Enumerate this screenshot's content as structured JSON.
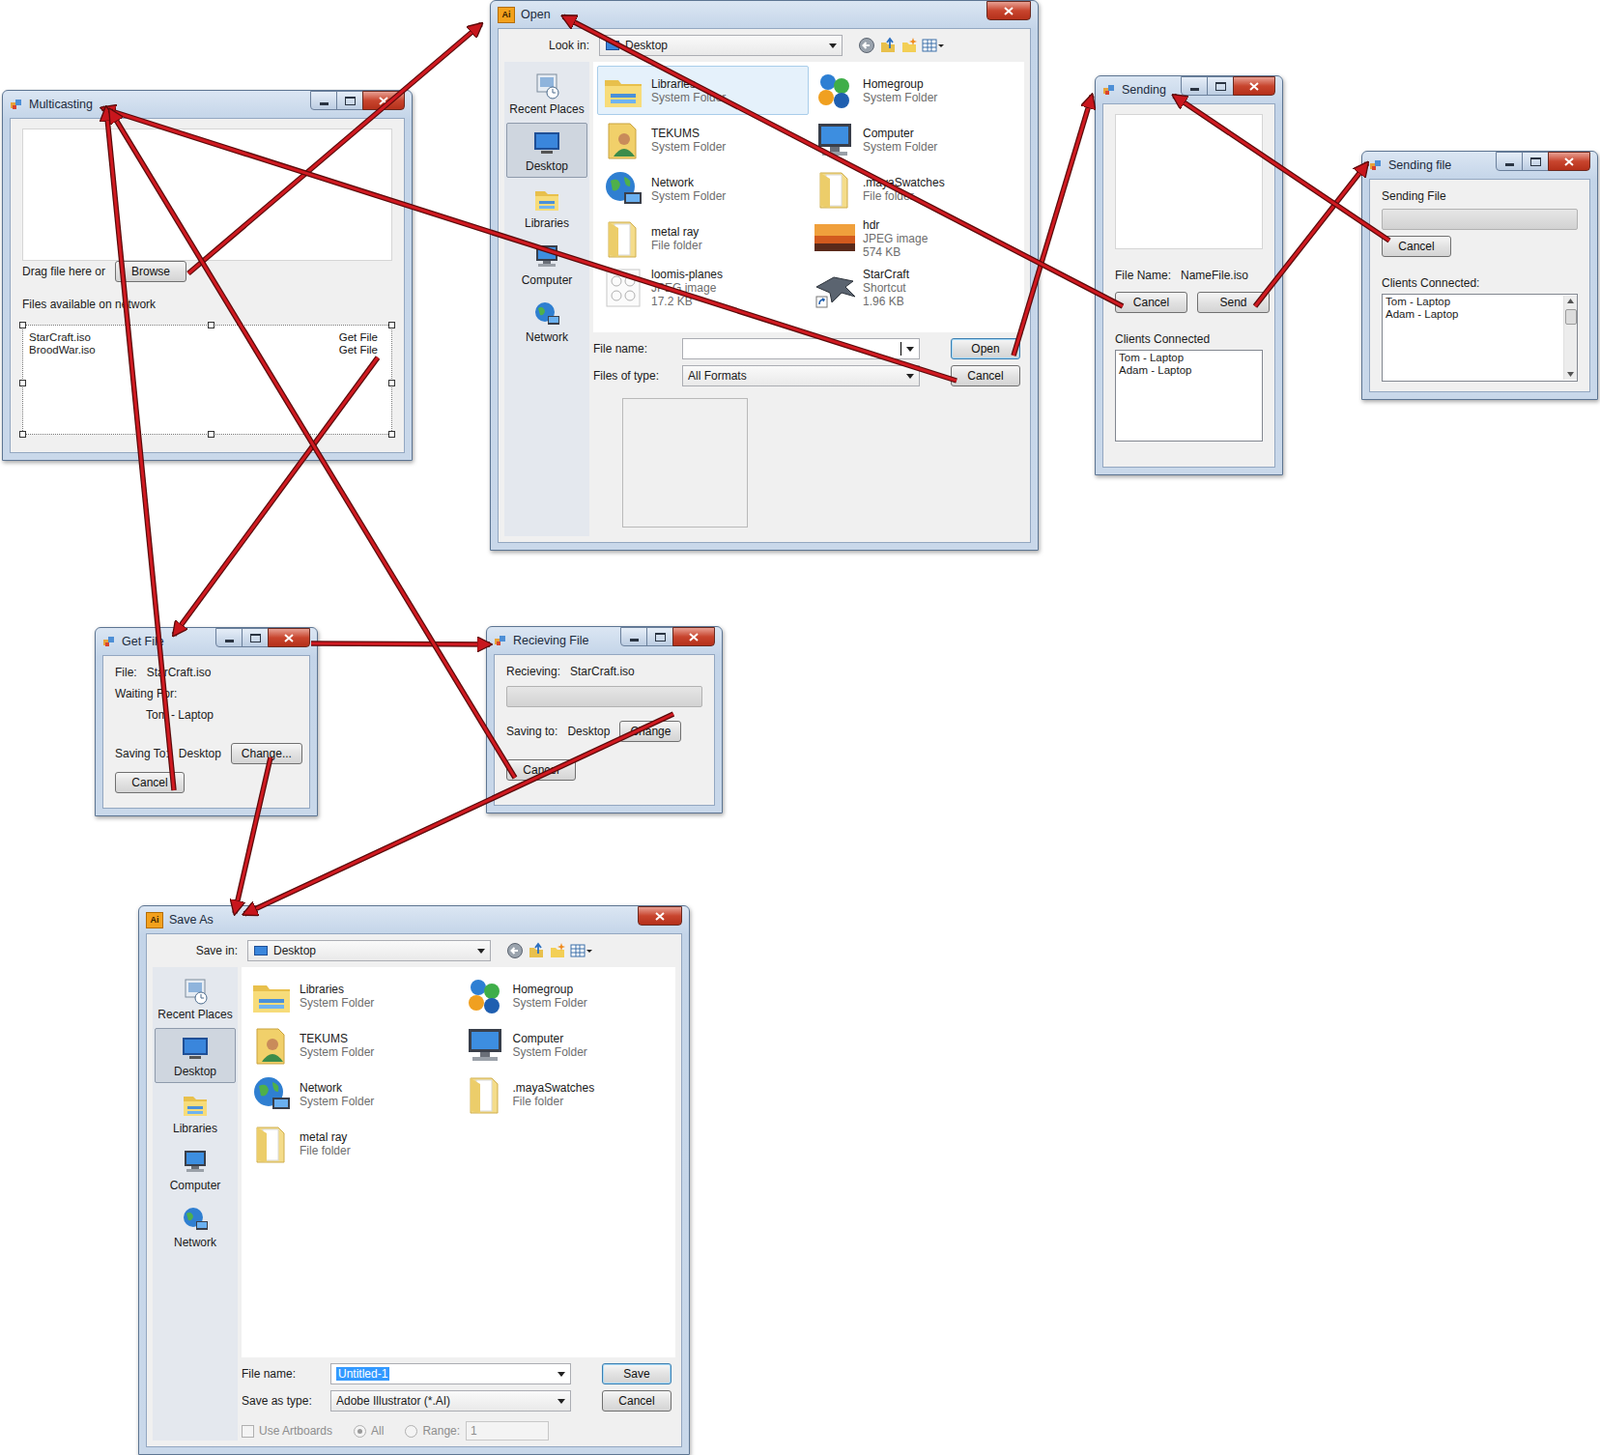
{
  "multicasting": {
    "title": "Multicasting",
    "drop_label": "Drag file here or",
    "browse_button": "Browse",
    "files_label": "Files available on network",
    "files": [
      {
        "name": "StarCraft.iso",
        "action": "Get File"
      },
      {
        "name": "BroodWar.iso",
        "action": "Get File"
      }
    ]
  },
  "open_dialog": {
    "title": "Open",
    "app_icon": "Ai",
    "location_label": "Look in:",
    "location": "Desktop",
    "places": [
      {
        "label": "Recent Places",
        "kind": "recent",
        "selected": false
      },
      {
        "label": "Desktop",
        "kind": "desktop",
        "selected": true
      },
      {
        "label": "Libraries",
        "kind": "library",
        "selected": false
      },
      {
        "label": "Computer",
        "kind": "computer",
        "selected": false
      },
      {
        "label": "Network",
        "kind": "network",
        "selected": false
      }
    ],
    "items": [
      {
        "name": "Libraries",
        "type": "System Folder",
        "size": "",
        "kind": "library",
        "selected": true
      },
      {
        "name": "Homegroup",
        "type": "System Folder",
        "size": "",
        "kind": "homegroup",
        "selected": false
      },
      {
        "name": "TEKUMS",
        "type": "System Folder",
        "size": "",
        "kind": "user",
        "selected": false
      },
      {
        "name": "Computer",
        "type": "System Folder",
        "size": "",
        "kind": "computer",
        "selected": false
      },
      {
        "name": "Network",
        "type": "System Folder",
        "size": "",
        "kind": "network",
        "selected": false
      },
      {
        "name": ".mayaSwatches",
        "type": "File folder",
        "size": "",
        "kind": "folder",
        "selected": false
      },
      {
        "name": "metal ray",
        "type": "File folder",
        "size": "",
        "kind": "folder",
        "selected": false
      },
      {
        "name": "hdr",
        "type": "JPEG image",
        "size": "574 KB",
        "kind": "photo",
        "selected": false
      },
      {
        "name": "loomis-planes",
        "type": "JPEG image",
        "size": "17.2 KB",
        "kind": "sketch",
        "selected": false
      },
      {
        "name": "StarCraft",
        "type": "Shortcut",
        "size": "1.96 KB",
        "kind": "shortcut",
        "selected": false
      }
    ],
    "file_name_label": "File name:",
    "file_name": "",
    "file_name_selected": false,
    "type_label": "Files of type:",
    "type": "All Formats",
    "primary_button": "Open",
    "cancel_button": "Cancel"
  },
  "sending": {
    "title": "Sending",
    "file_name_label": "File Name:",
    "file_name": "NameFile.iso",
    "cancel_button": "Cancel",
    "send_button": "Send",
    "clients_label": "Clients Connected",
    "clients": [
      "Tom - Laptop",
      "Adam - Laptop"
    ]
  },
  "sending_file": {
    "title": "Sending file",
    "progress_label": "Sending File",
    "level": 0,
    "cancel_button": "Cancel",
    "clients_label": "Clients Connected:",
    "clients": [
      "Tom - Laptop",
      "Adam - Laptop"
    ]
  },
  "get_file": {
    "title": "Get File",
    "file_label": "File:",
    "file": "StarCraft.iso",
    "waiting_label": "Waiting For:",
    "waiting_for": "Tom - Laptop",
    "saving_label": "Saving To:",
    "saving_to": "Desktop",
    "change_button": "Change...",
    "cancel_button": "Cancel"
  },
  "receiving_file": {
    "title": "Recieving File",
    "file_label": "Recieving:",
    "file": "StarCraft.iso",
    "level": 0,
    "saving_label": "Saving to:",
    "saving_to": "Desktop",
    "change_button": "Change",
    "cancel_button": "Cancel"
  },
  "save_dialog": {
    "title": "Save As",
    "app_icon": "Ai",
    "location_label": "Save in:",
    "location": "Desktop",
    "places": [
      {
        "label": "Recent Places",
        "kind": "recent",
        "selected": false
      },
      {
        "label": "Desktop",
        "kind": "desktop",
        "selected": true
      },
      {
        "label": "Libraries",
        "kind": "library",
        "selected": false
      },
      {
        "label": "Computer",
        "kind": "computer",
        "selected": false
      },
      {
        "label": "Network",
        "kind": "network",
        "selected": false
      }
    ],
    "items": [
      {
        "name": "Libraries",
        "type": "System Folder",
        "size": "",
        "kind": "library",
        "selected": false
      },
      {
        "name": "Homegroup",
        "type": "System Folder",
        "size": "",
        "kind": "homegroup",
        "selected": false
      },
      {
        "name": "TEKUMS",
        "type": "System Folder",
        "size": "",
        "kind": "user",
        "selected": false
      },
      {
        "name": "Computer",
        "type": "System Folder",
        "size": "",
        "kind": "computer",
        "selected": false
      },
      {
        "name": "Network",
        "type": "System Folder",
        "size": "",
        "kind": "network",
        "selected": false
      },
      {
        "name": ".mayaSwatches",
        "type": "File folder",
        "size": "",
        "kind": "folder",
        "selected": false
      },
      {
        "name": "metal ray",
        "type": "File folder",
        "size": "",
        "kind": "folder",
        "selected": false
      }
    ],
    "file_name_label": "File name:",
    "file_name": "Untitled-1",
    "file_name_selected": true,
    "type_label": "Save as type:",
    "type": "Adobe Illustrator (*.AI)",
    "primary_button": "Save",
    "cancel_button": "Cancel",
    "artboards": {
      "label": "Use Artboards",
      "checked": false,
      "disabled": true
    },
    "range_options": [
      {
        "label": "All",
        "selected": true,
        "disabled": true
      },
      {
        "label": "Range:",
        "selected": false,
        "disabled": true
      }
    ],
    "range_value": "1"
  }
}
